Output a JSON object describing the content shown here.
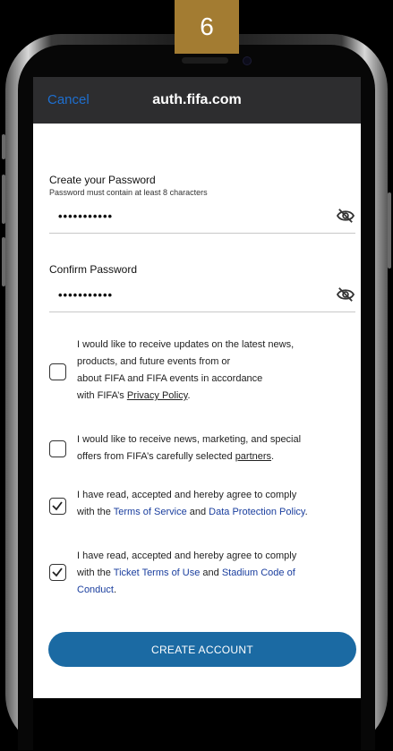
{
  "step_badge": "6",
  "nav": {
    "cancel_label": "Cancel",
    "title": "auth.fifa.com"
  },
  "create_password": {
    "label": "Create your Password",
    "hint": "Password must contain at least 8 characters",
    "masked_value": "•••••••••••"
  },
  "confirm_password": {
    "label": "Confirm Password",
    "masked_value": "•••••••••••"
  },
  "consents": [
    {
      "checked": false,
      "lines": [
        "I would like to receive updates on the latest news,",
        "products, and future events from or",
        "about FIFA and FIFA events in accordance"
      ],
      "tail_prefix": "with FIFA’s ",
      "tail_link": "Privacy Policy",
      "tail_suffix": "."
    },
    {
      "checked": false,
      "line1": "I would like to receive news, marketing, and special",
      "tail_prefix": "offers from FIFA’s carefully selected ",
      "tail_link": "partners",
      "tail_suffix": "."
    },
    {
      "checked": true,
      "line1": "I have read, accepted and hereby agree to comply",
      "prefix": "with the ",
      "link1": "Terms of Service",
      "middle": " and ",
      "link2": "Data Protection Policy",
      "suffix": "."
    },
    {
      "checked": true,
      "line1": "I have read, accepted and hereby agree to comply",
      "prefix": "with the ",
      "link1": "Ticket Terms of Use",
      "middle": " and ",
      "link2": "Stadium Code of",
      "link2_cont": "Conduct",
      "suffix": "."
    }
  ],
  "create_account_label": "CREATE ACCOUNT",
  "colors": {
    "accent_blue": "#1b6aa3",
    "link_blue": "#1a3e9e",
    "badge_gold": "#a37c32"
  }
}
